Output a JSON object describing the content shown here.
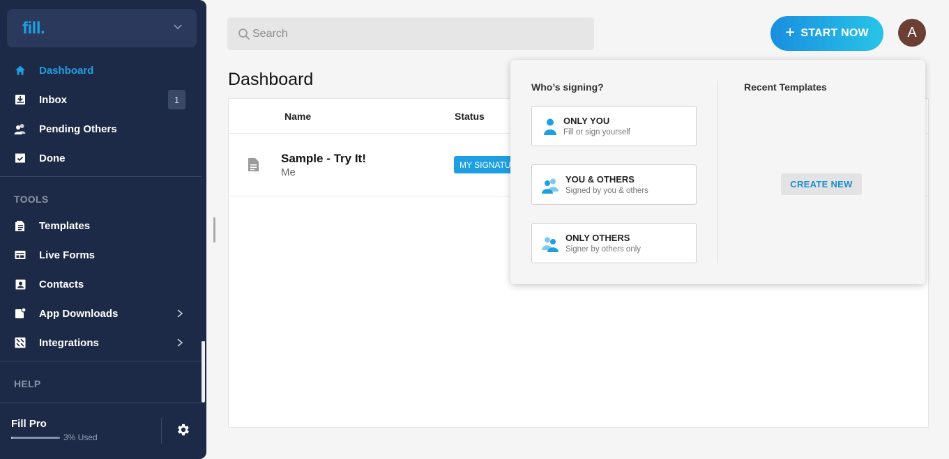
{
  "app": {
    "logo": "fill."
  },
  "sidebar": {
    "items": [
      {
        "label": "Dashboard"
      },
      {
        "label": "Inbox",
        "badge": "1"
      },
      {
        "label": "Pending Others"
      },
      {
        "label": "Done"
      }
    ],
    "tools_heading": "TOOLS",
    "tools": [
      {
        "label": "Templates"
      },
      {
        "label": "Live Forms"
      },
      {
        "label": "Contacts"
      },
      {
        "label": "App Downloads"
      },
      {
        "label": "Integrations"
      }
    ],
    "help_heading": "HELP",
    "plan": "Fill Pro",
    "usage_text": "3% Used",
    "usage_fraction": 0.03
  },
  "search": {
    "placeholder": "Search"
  },
  "header": {
    "start_label": "START NOW",
    "avatar_letter": "A"
  },
  "main": {
    "title": "Dashboard",
    "columns": [
      "Name",
      "Status"
    ],
    "rows": [
      {
        "name": "Sample - Try It!",
        "owner": "Me",
        "status": "MY SIGNATURE"
      }
    ]
  },
  "popup": {
    "signing_heading": "Who’s signing?",
    "templates_heading": "Recent Templates",
    "options": [
      {
        "title": "ONLY YOU",
        "subtitle": "Fill or sign yourself"
      },
      {
        "title": "YOU & OTHERS",
        "subtitle": "Signed by you & others"
      },
      {
        "title": "ONLY OTHERS",
        "subtitle": "Signer by others only"
      }
    ],
    "create_label": "CREATE NEW"
  },
  "colors": {
    "sidebar_bg": "#1d2a47",
    "accent": "#1e9fe3",
    "avatar_bg": "#6b3f33"
  }
}
